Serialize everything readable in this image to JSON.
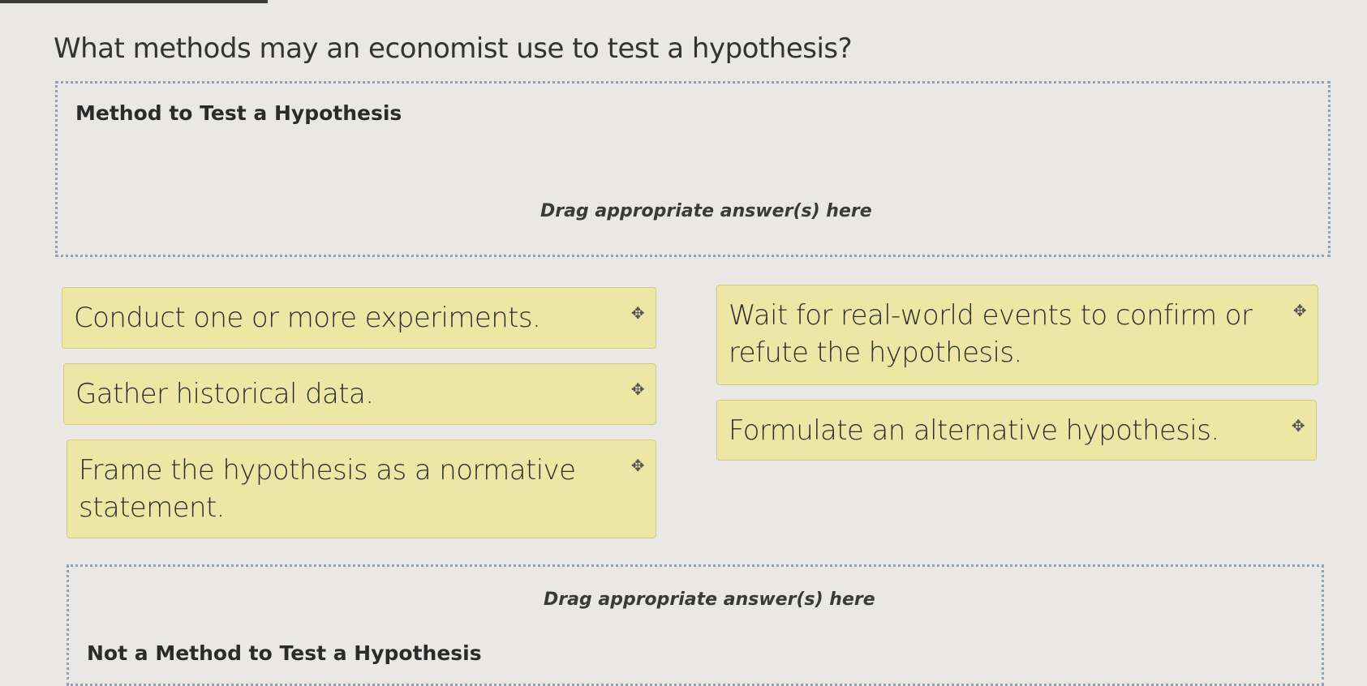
{
  "question": "What methods may an economist use to test a hypothesis?",
  "zones": {
    "method": {
      "title": "Method to Test a Hypothesis",
      "hint": "Drag appropriate answer(s) here"
    },
    "not_method": {
      "title": "Not a Method to Test a Hypothesis",
      "hint": "Drag appropriate answer(s) here"
    }
  },
  "answers": [
    "Conduct one or more experiments.",
    "Gather historical data.",
    "Frame the hypothesis as a normative statement.",
    "Wait for real-world events to confirm or refute the hypothesis.",
    "Formulate an alternative hypothesis."
  ],
  "icons": {
    "drag_handle": "move-icon"
  },
  "colors": {
    "chip_bg": "#ede7a6",
    "zone_border": "#8fa3b8"
  }
}
